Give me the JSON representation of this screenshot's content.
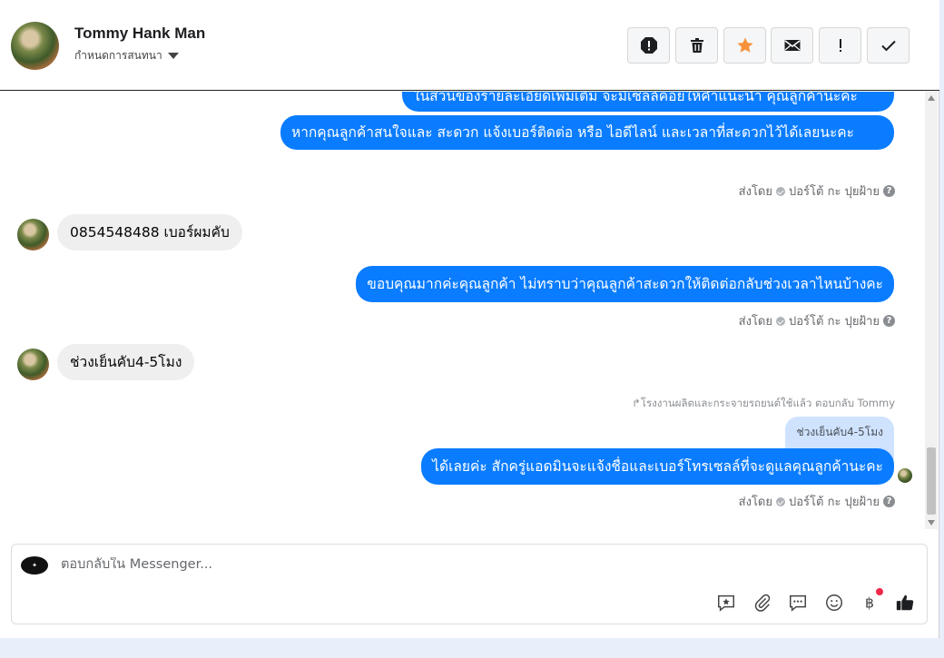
{
  "header": {
    "name": "Tommy Hank Man",
    "assign_label": "กำหนดการสนทนา",
    "tools": [
      {
        "icon": "alert-circle-icon"
      },
      {
        "icon": "trash-icon"
      },
      {
        "icon": "star-icon",
        "color": "#f7923b"
      },
      {
        "icon": "envelope-icon"
      },
      {
        "icon": "exclamation-icon"
      },
      {
        "icon": "check-icon"
      }
    ]
  },
  "messages": {
    "m0": "ในส่วนของรายละเอียดเพิ่มเติม จะมีเซลล์คอยให้คำแนะนำ คุณลูกค้านะคะ",
    "m1": "หากคุณลูกค้าสนใจและ สะดวก แจ้งเบอร์ติดต่อ หรือ ไอดีไลน์ และเวลาที่สะดวกไว้ได้เลยนะคะ",
    "m2": "0854548488 เบอร์ผมคับ",
    "m3": "ขอบคุณมากค่ะคุณลูกค้า ไม่ทราบว่าคุณลูกค้าสะดวกให้ติดต่อกลับช่วงเวลาไหนบ้างคะ",
    "m4": "ช่วงเย็นคับ4-5โมง",
    "reply_note": "โรงงานผลิตและกระจายรถยนต์ใช้แล้ว ตอบกลับ Tommy",
    "quoted": "ช่วงเย็นคับ4-5โมง",
    "m5": "ได้เลยค่ะ สักครู่แอดมินจะแจ้งชื่อและเบอร์โทรเซลล์ที่จะดูแลคุณลูกค้านะคะ"
  },
  "meta": {
    "sent_by": "ส่งโดย",
    "sender": "ปอร์โต้ กะ ปุยฝ้าย"
  },
  "composer": {
    "placeholder": "ตอบกลับใน Messenger...",
    "icons": [
      "saved-reply-icon",
      "attachment-icon",
      "quick-reply-icon",
      "emoji-icon",
      "baht-payment-icon",
      "thumbs-up-icon"
    ]
  },
  "colors": {
    "outgoing": "#0a7cff",
    "incoming": "#efefef",
    "notification_dot": "#f02849"
  }
}
